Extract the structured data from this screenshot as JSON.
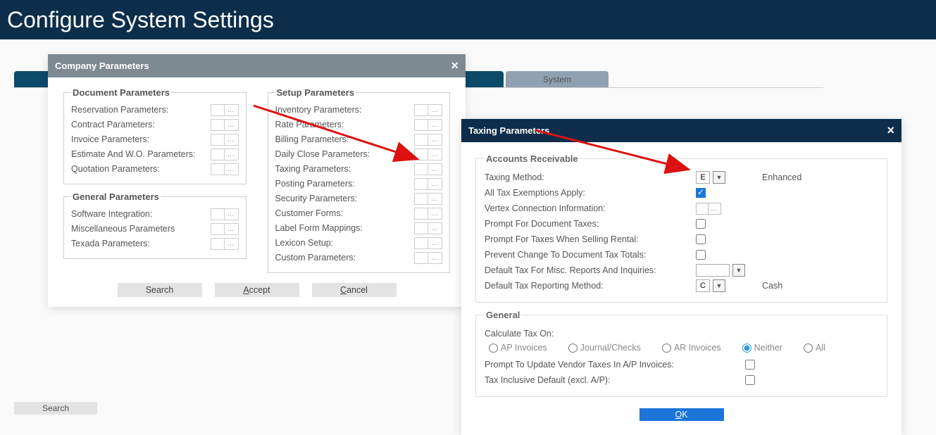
{
  "page": {
    "title": "Configure System Settings"
  },
  "tabs": {
    "system": "System"
  },
  "company_panel": {
    "title": "Company Parameters",
    "groups": {
      "document": {
        "legend": "Document Parameters",
        "items": [
          "Reservation Parameters:",
          "Contract Parameters:",
          "Invoice Parameters:",
          "Estimate And W.O. Parameters:",
          "Quotation Parameters:"
        ]
      },
      "general": {
        "legend": "General Parameters",
        "items": [
          "Software Integration:",
          "Miscellaneous Parameters",
          "Texada Parameters:"
        ]
      },
      "setup": {
        "legend": "Setup Parameters",
        "items": [
          "Inventory Parameters:",
          "Rate Parameters:",
          "Billing Parameters:",
          "Daily Close Parameters:",
          "Taxing Parameters:",
          "Posting Parameters:",
          "Security Parameters:",
          "Customer Forms:",
          "Label Form Mappings:",
          "Lexicon Setup:",
          "Custom Parameters:"
        ]
      }
    },
    "actions": {
      "search": "Search",
      "accept": "Accept",
      "cancel": "Cancel"
    }
  },
  "taxing_panel": {
    "title": "Taxing Parameters",
    "ar_legend": "Accounts Receivable",
    "general_legend": "General",
    "rows": {
      "taxing_method": {
        "label": "Taxing Method:",
        "value": "E",
        "after": "Enhanced"
      },
      "exemptions": {
        "label": "All Tax Exemptions Apply:",
        "checked": true
      },
      "vertex": {
        "label": "Vertex Connection Information:"
      },
      "prompt_doc": {
        "label": "Prompt For Document Taxes:",
        "checked": false
      },
      "prompt_sell": {
        "label": "Prompt For Taxes When Selling Rental:",
        "checked": false
      },
      "prevent": {
        "label": "Prevent Change To Document Tax Totals:",
        "checked": false
      },
      "default_misc": {
        "label": "Default Tax For Misc. Reports And Inquiries:"
      },
      "default_report": {
        "label": "Default Tax Reporting Method:",
        "value": "C",
        "after": "Cash"
      },
      "calc_on": {
        "label": "Calculate Tax On:"
      },
      "radios": {
        "ap": "AP Invoices",
        "journal": "Journal/Checks",
        "ar": "AR Invoices",
        "neither": "Neither",
        "all": "All",
        "selected": "neither"
      },
      "prompt_vendor": {
        "label": "Prompt To Update Vendor Taxes In A/P Invoices:",
        "checked": false
      },
      "tax_incl": {
        "label": "Tax Inclusive Default (excl. A/P):",
        "checked": false
      }
    },
    "ok": "OK"
  },
  "bottom_search": "Search"
}
